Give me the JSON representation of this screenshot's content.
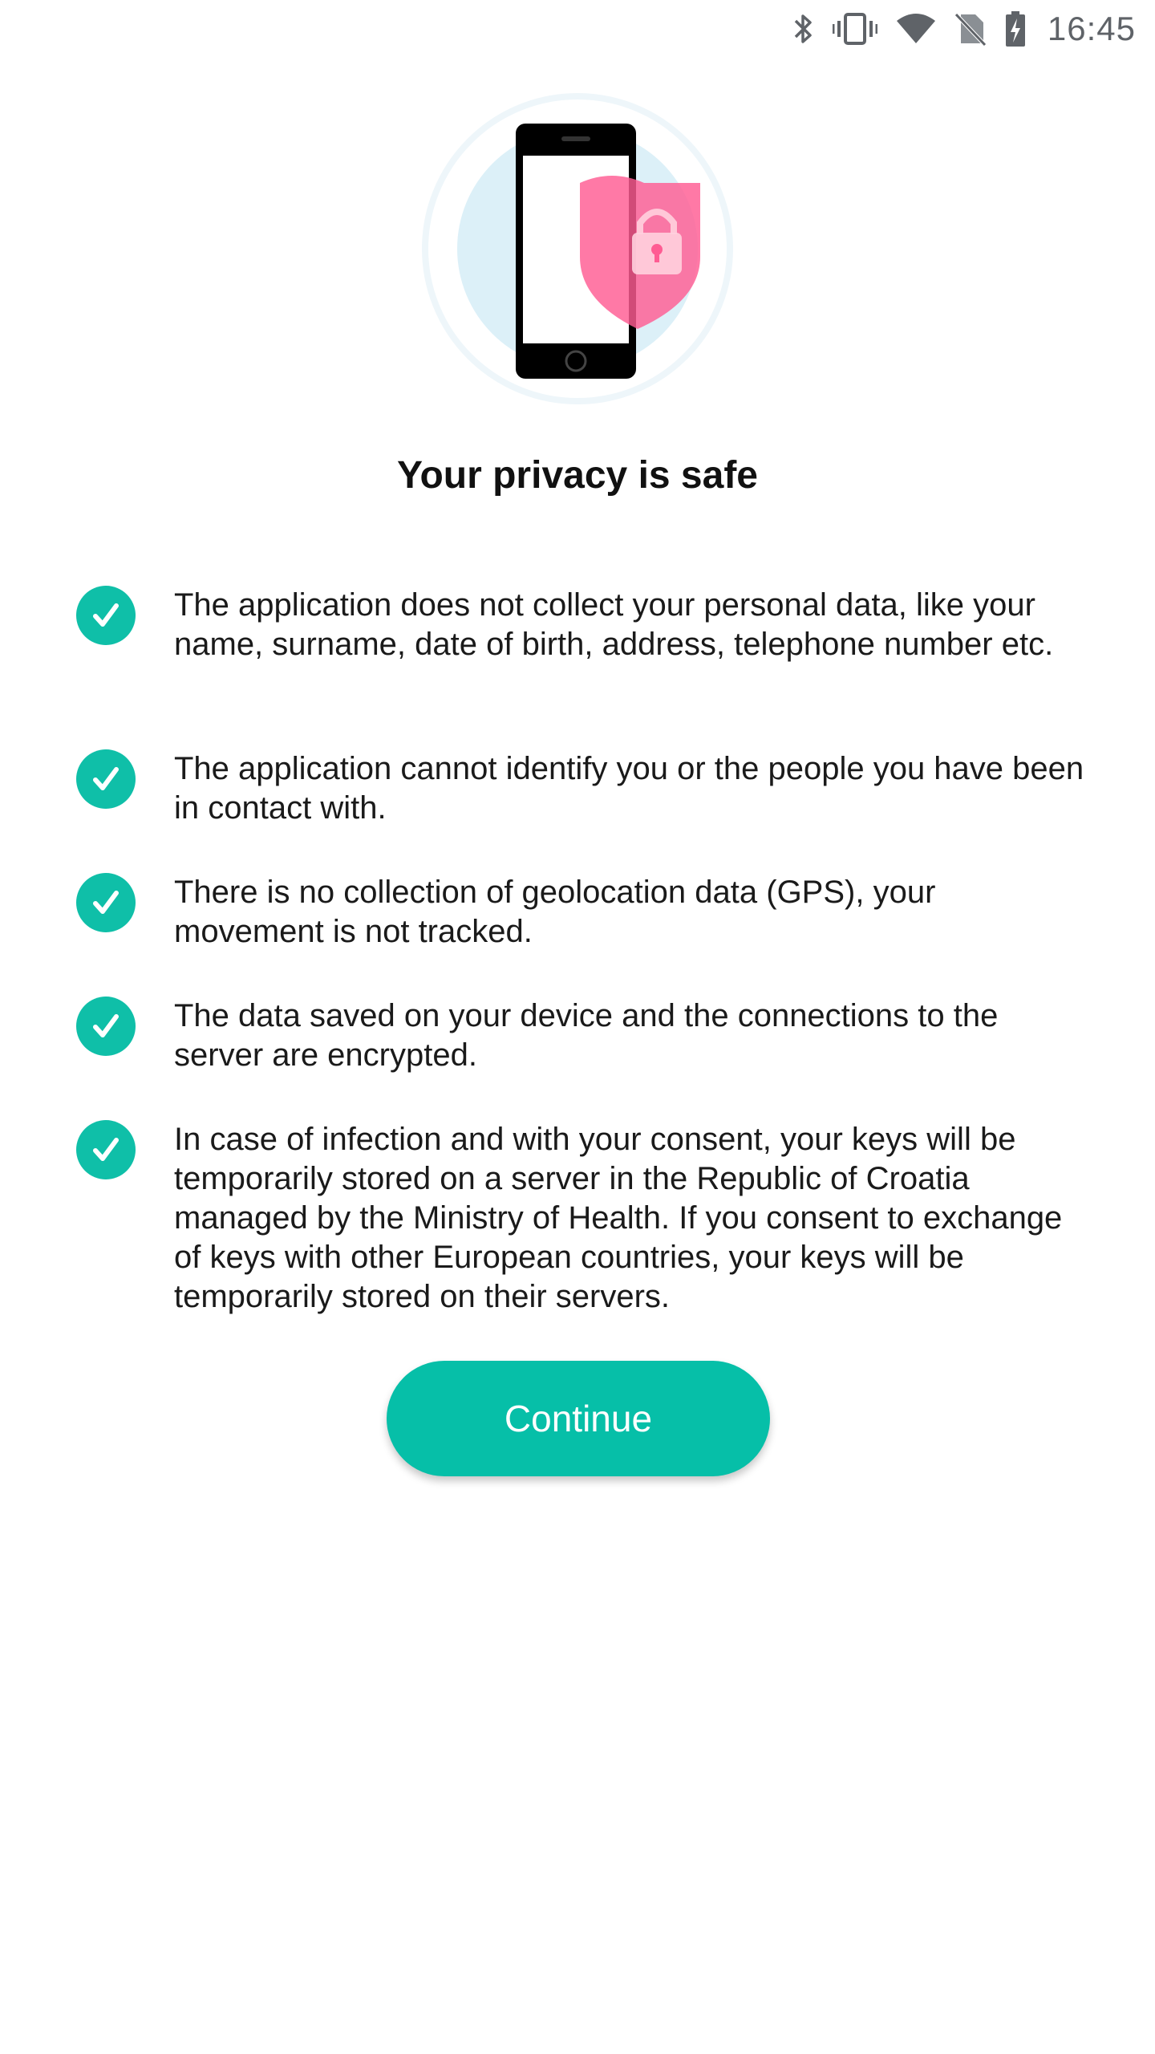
{
  "status_bar": {
    "time": "16:45",
    "icons": [
      "bluetooth-icon",
      "vibrate-icon",
      "wifi-icon",
      "no-sim-icon",
      "battery-charging-icon"
    ]
  },
  "hero": {
    "illustration": "phone-with-shield-lock-icon",
    "colors": {
      "circle": "#dff0f7",
      "phone": "#000000",
      "shield": "#ff5c93"
    }
  },
  "title": "Your privacy is safe",
  "points": [
    {
      "text": "The application does not collect your personal data, like your name, surname, date of birth, address, telephone number etc."
    },
    {
      "text": "The application cannot identify you or the people you have been in contact with."
    },
    {
      "text": "There is no collection of geolocation data (GPS), your movement is not tracked."
    },
    {
      "text": "The data saved on your device and the connections to the server are encrypted."
    },
    {
      "text": "In case of infection and with your consent, your keys will be temporarily stored on a server in the Republic of Croatia managed by the Ministry of Health. If you consent to exchange of keys with other European countries, your keys will be temporarily stored on their servers."
    }
  ],
  "continue_button": {
    "label": "Continue"
  },
  "colors": {
    "accent": "#06bfa8",
    "text": "#1a1a1a"
  }
}
